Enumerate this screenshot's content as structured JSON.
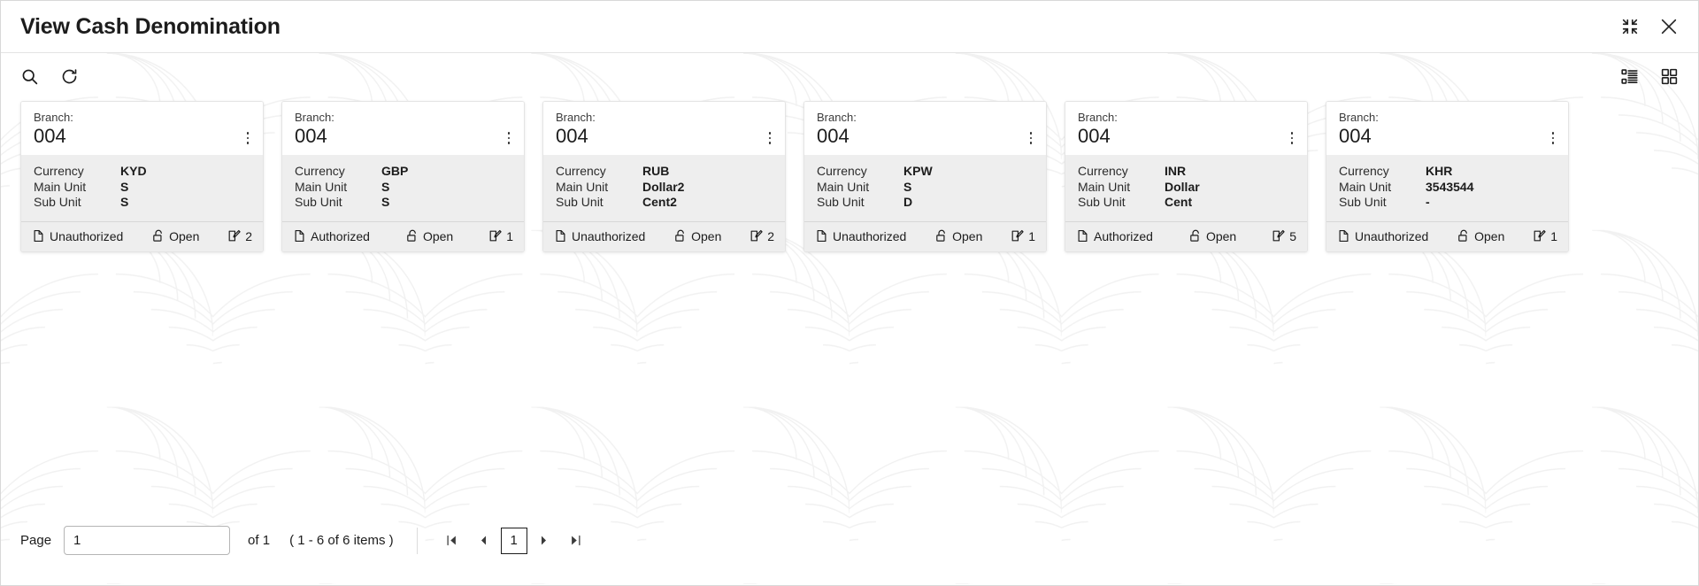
{
  "window": {
    "title": "View Cash Denomination",
    "minimize_icon": "collapse-icon",
    "close_icon": "close-icon"
  },
  "toolbar": {
    "search_icon": "search-icon",
    "refresh_icon": "refresh-icon",
    "list_view_icon": "list-view-icon",
    "grid_view_icon": "grid-view-icon"
  },
  "card_labels": {
    "branch": "Branch:",
    "currency": "Currency",
    "main_unit": "Main Unit",
    "sub_unit": "Sub Unit"
  },
  "cards": [
    {
      "branch": "004",
      "currency": "KYD",
      "main_unit": "S",
      "sub_unit": "S",
      "status": "Unauthorized",
      "lock": "Open",
      "edits": "2"
    },
    {
      "branch": "004",
      "currency": "GBP",
      "main_unit": "S",
      "sub_unit": "S",
      "status": "Authorized",
      "lock": "Open",
      "edits": "1"
    },
    {
      "branch": "004",
      "currency": "RUB",
      "main_unit": "Dollar2",
      "sub_unit": "Cent2",
      "status": "Unauthorized",
      "lock": "Open",
      "edits": "2"
    },
    {
      "branch": "004",
      "currency": "KPW",
      "main_unit": "S",
      "sub_unit": "D",
      "status": "Unauthorized",
      "lock": "Open",
      "edits": "1"
    },
    {
      "branch": "004",
      "currency": "INR",
      "main_unit": "Dollar",
      "sub_unit": "Cent",
      "status": "Authorized",
      "lock": "Open",
      "edits": "5"
    },
    {
      "branch": "004",
      "currency": "KHR",
      "main_unit": "3543544",
      "sub_unit": "-",
      "status": "Unauthorized",
      "lock": "Open",
      "edits": "1"
    }
  ],
  "pagination": {
    "page_label": "Page",
    "page_value": "1",
    "of_text": "of 1",
    "items_text": "( 1 - 6 of 6 items )",
    "first_label": "first-page",
    "prev_label": "previous-page",
    "current_page": "1",
    "next_label": "next-page",
    "last_label": "last-page"
  },
  "colors": {
    "card_body_bg": "#eeeeee",
    "card_border": "#e4e4e4",
    "text": "#1c1c1c"
  }
}
